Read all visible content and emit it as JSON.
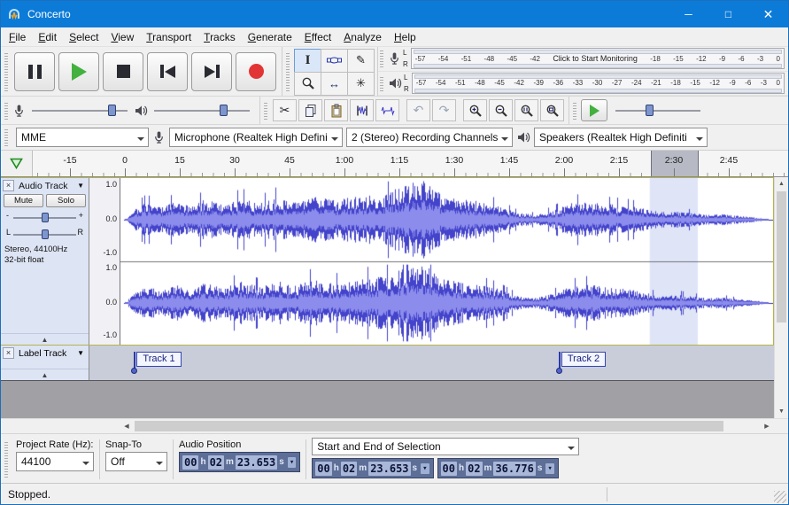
{
  "titlebar": {
    "title": "Concerto",
    "minimize": "─",
    "maximize": "□",
    "close": "✕"
  },
  "menu": {
    "items": [
      "File",
      "Edit",
      "Select",
      "View",
      "Transport",
      "Tracks",
      "Generate",
      "Effect",
      "Analyze",
      "Help"
    ]
  },
  "toolbars": {
    "transport": {
      "buttons": [
        "pause",
        "play",
        "stop",
        "skip-to-start",
        "skip-to-end",
        "record"
      ]
    },
    "tools": {
      "buttons": [
        "selection-tool",
        "envelope-tool",
        "draw-tool",
        "zoom-tool",
        "time-shift-tool",
        "multi-tool"
      ],
      "active": "selection-tool"
    },
    "edit": {
      "buttons": [
        "cut",
        "copy",
        "paste",
        "trim-audio",
        "silence-audio",
        "undo",
        "redo",
        "zoom-in",
        "zoom-out",
        "fit-selection",
        "fit-project"
      ]
    },
    "meters": {
      "record": {
        "channel_labels": [
          "L",
          "R"
        ],
        "ticks_left": [
          "-57",
          "-54",
          "-51",
          "-48",
          "-45",
          "-42"
        ],
        "message": "Click to Start Monitoring",
        "ticks_right": [
          "-18",
          "-15",
          "-12",
          "-9",
          "-6",
          "-3",
          "0"
        ]
      },
      "play": {
        "channel_labels": [
          "L",
          "R"
        ],
        "ticks": [
          "-57",
          "-54",
          "-51",
          "-48",
          "-45",
          "-42",
          "-39",
          "-36",
          "-33",
          "-30",
          "-27",
          "-24",
          "-21",
          "-18",
          "-15",
          "-12",
          "-9",
          "-6",
          "-3",
          "0"
        ]
      }
    }
  },
  "device_toolbar": {
    "host": "MME",
    "input_device": "Microphone (Realtek High Defini",
    "input_channels": "2 (Stereo) Recording Channels",
    "output_device": "Speakers (Realtek High Definiti"
  },
  "timeline": {
    "labels": [
      "-15",
      "0",
      "15",
      "30",
      "45",
      "1:00",
      "1:15",
      "1:30",
      "1:45",
      "2:00",
      "2:15",
      "2:30",
      "2:45"
    ],
    "selection": {
      "start_s": 143.653,
      "end_s": 156.776
    }
  },
  "audio_track": {
    "close": "×",
    "name": "Audio Track",
    "menu_arrow": "▼",
    "mute": "Mute",
    "solo": "Solo",
    "gain_min": "-",
    "gain_max": "+",
    "pan_left": "L",
    "pan_right": "R",
    "info_line1": "Stereo, 44100Hz",
    "info_line2": "32-bit float",
    "collapse": "▲",
    "scale_labels": [
      "1.0",
      "0.0",
      "-1.0"
    ]
  },
  "label_track": {
    "close": "×",
    "name": "Label Track",
    "menu_arrow": "▼",
    "collapse": "▲",
    "labels": [
      {
        "text": "Track 1",
        "time_s": 3.0
      },
      {
        "text": "Track 2",
        "time_s": 119.0
      }
    ]
  },
  "selection_toolbar": {
    "project_rate_label": "Project Rate (Hz):",
    "project_rate": "44100",
    "snap_label": "Snap-To",
    "snap_value": "Off",
    "audio_position_label": "Audio Position",
    "audio_position": "00 h 02 m 23.653 s",
    "selection_mode": "Start and End of Selection",
    "selection_start": "00 h 02 m 23.653 s",
    "selection_end": "00 h 02 m 36.776 s"
  },
  "status_bar": {
    "text": "Stopped."
  }
}
